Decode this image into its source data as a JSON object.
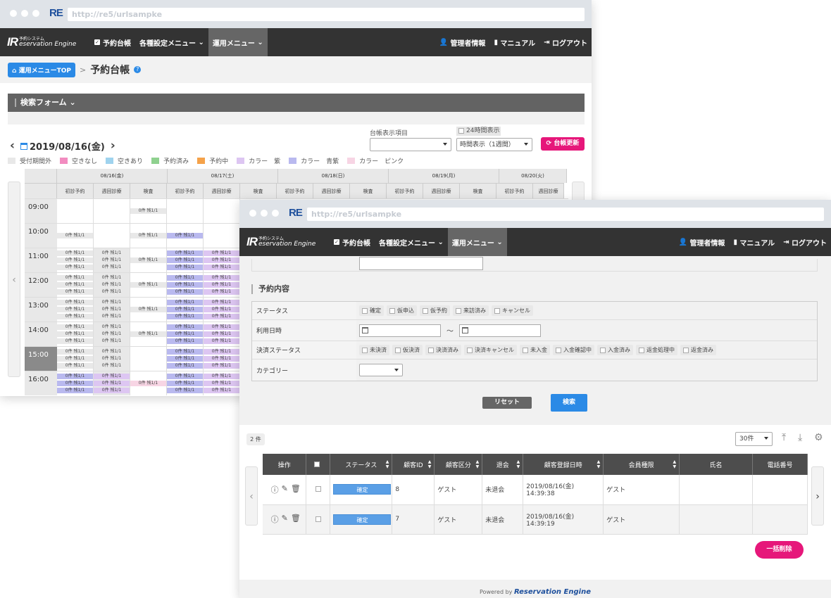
{
  "browser": {
    "url": "http://re5/urlsampke",
    "badge": "RE"
  },
  "brand": {
    "logo_main": "IR",
    "logo_sub": "eservation Engine",
    "logo_kana": "予約システム"
  },
  "nav": {
    "items": [
      "予約台帳",
      "各種設定メニュー",
      "運用メニュー"
    ],
    "right": [
      "管理者情報",
      "マニュアル",
      "ログアウト"
    ]
  },
  "crumb": {
    "top": "運用メニューTOP",
    "sep": ">",
    "title": "予約台帳"
  },
  "search_form": {
    "title": "検索フォーム"
  },
  "ledger": {
    "date": "2019/08/16(金)",
    "display_label": "台帳表示項目",
    "h24": "24時間表示",
    "time_mode": "時間表示（1週間）",
    "update_btn": "台帳更新",
    "legend": [
      {
        "label": "受付期間外",
        "color": "#e8e8e8"
      },
      {
        "label": "空きなし",
        "color": "#f28cc0"
      },
      {
        "label": "空きあり",
        "color": "#9fd3ee"
      },
      {
        "label": "予約済み",
        "color": "#8fd18f"
      },
      {
        "label": "予約中",
        "color": "#f5a24a"
      },
      {
        "label": "カラー　紫",
        "color": "#ddc6f2"
      },
      {
        "label": "カラー　青紫",
        "color": "#b9b9ef"
      },
      {
        "label": "カラー　ピンク",
        "color": "#f7d5e4"
      }
    ],
    "days": [
      "08/16(金)",
      "08/17(土)",
      "08/18(日)",
      "08/19(月)",
      "08/20(火)"
    ],
    "sub_cols": [
      "初診予約",
      "週回診療",
      "検査"
    ],
    "times": [
      "09:00",
      "10:00",
      "11:00",
      "12:00",
      "13:00",
      "14:00",
      "15:00",
      "16:00"
    ],
    "current_time": "15:00",
    "slot_text": "0件 残1/1"
  },
  "filter": {
    "section": "予約内容",
    "status_label": "ステータス",
    "status_opts": [
      "確定",
      "仮申込",
      "仮予約",
      "来訪済み",
      "キャンセル"
    ],
    "date_label": "利用日時",
    "tilde": "～",
    "pay_label": "決済ステータス",
    "pay_opts": [
      "未決済",
      "仮決済",
      "決済済み",
      "決済キャンセル",
      "未入金",
      "入金確認中",
      "入金済み",
      "返金処理中",
      "返金済み"
    ],
    "cat_label": "カテゴリー",
    "reset": "リセット",
    "search": "検索"
  },
  "results": {
    "count": "2 件",
    "per_page": "30件",
    "headers": [
      "操作",
      "",
      "ステータス",
      "顧客ID",
      "顧客区分",
      "退会",
      "顧客登録日時",
      "会員種限",
      "氏名",
      "電話番号"
    ],
    "rows": [
      {
        "status": "確定",
        "id": "8",
        "kubun": "ゲスト",
        "taikai": "未退会",
        "date": "2019/08/16(金) 14:39:38",
        "kaiin": "ゲスト"
      },
      {
        "status": "確定",
        "id": "7",
        "kubun": "ゲスト",
        "taikai": "未退会",
        "date": "2019/08/16(金) 14:39:19",
        "kaiin": "ゲスト"
      }
    ],
    "bulk_delete": "一括削除"
  },
  "footer": {
    "powered": "Powered by",
    "brand": "Reservation Engine"
  }
}
